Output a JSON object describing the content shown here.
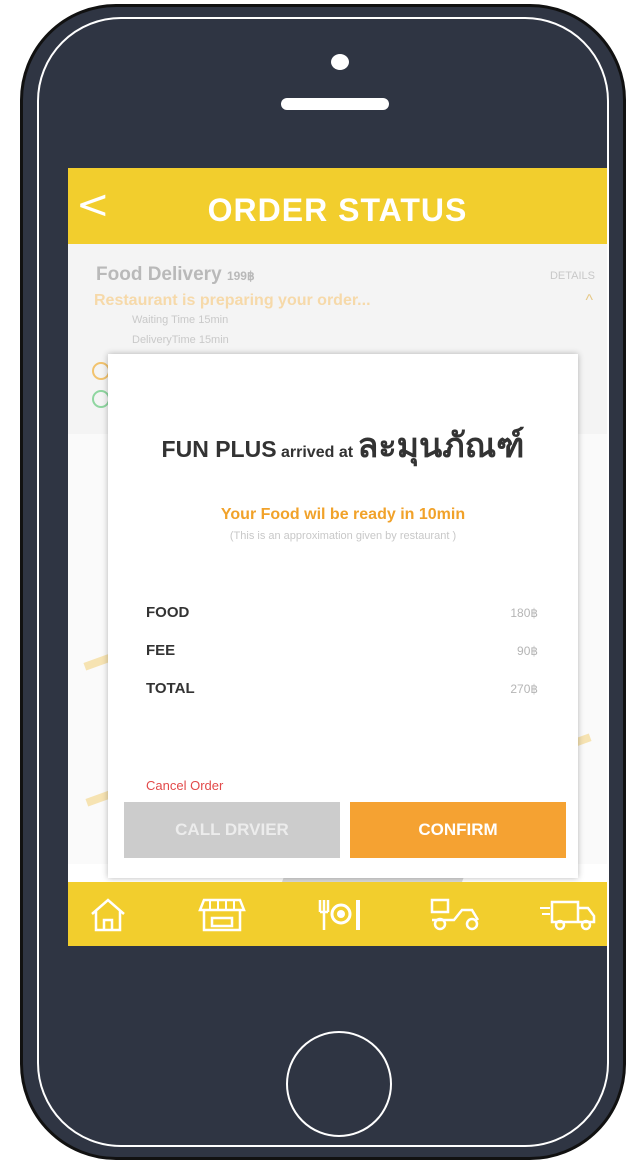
{
  "header": {
    "title": "ORDER STATUS",
    "back_label": "<"
  },
  "order": {
    "name": "Food Delivery",
    "price": "199฿",
    "details_label": "DETAILS",
    "status": "Restaurant is preparing your order...",
    "waiting_time": "Waiting Time 15min",
    "delivery_time": "DeliveryTime 15min"
  },
  "modal": {
    "brand": "FUN PLUS",
    "verb": "arrived at",
    "place": "ละมุนภัณฑ์",
    "ready_text": "Your Food wil be ready in 10min",
    "approx_text": "(This is an approximation given by restaurant )",
    "rows": [
      {
        "label": "FOOD",
        "value": "180฿"
      },
      {
        "label": "FEE",
        "value": "90฿"
      },
      {
        "label": "TOTAL",
        "value": "270฿"
      }
    ],
    "cancel_label": "Cancel Order",
    "call_label": "CALL DRVIER",
    "confirm_label": "CONFIRM"
  },
  "nav": {
    "items": [
      {
        "icon": "home-icon"
      },
      {
        "icon": "shop-icon"
      },
      {
        "icon": "plate-cutlery-icon"
      },
      {
        "icon": "scooter-icon"
      },
      {
        "icon": "delivery-truck-icon"
      }
    ]
  },
  "colors": {
    "accent": "#f2ce2d",
    "confirm": "#f5a232",
    "cancel": "#e24a4a",
    "phone": "#2f3543"
  }
}
